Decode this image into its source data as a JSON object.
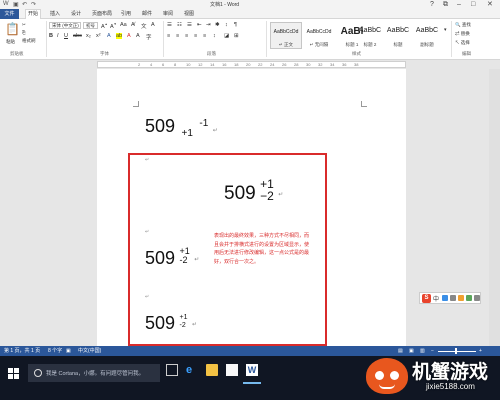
{
  "window": {
    "title": "文档1 - Word",
    "controls": [
      "?",
      "⧉",
      "–",
      "□",
      "✕"
    ]
  },
  "ribbon_tabs": {
    "file": "文件",
    "tabs": [
      "开始",
      "插入",
      "设计",
      "页面布局",
      "引用",
      "邮件",
      "审阅",
      "视图"
    ],
    "active": "开始"
  },
  "clipboard": {
    "paste": "粘贴",
    "cut": "✂",
    "copy": "⎘",
    "format_painter": "格式刷",
    "label": "剪贴板"
  },
  "font": {
    "name": "宋体 (中文正)",
    "size": "初号",
    "label": "字体"
  },
  "paragraph": {
    "label": "段落"
  },
  "styles": {
    "items": [
      {
        "preview": "AaBbCcDd",
        "name": "↵ 正文",
        "selected": true
      },
      {
        "preview": "AaBbCcDd",
        "name": "↵ 无间隔",
        "selected": false
      },
      {
        "preview": "AaBl",
        "name": "标题 1",
        "selected": false
      },
      {
        "preview": "AaBbC",
        "name": "标题 2",
        "selected": false
      },
      {
        "preview": "AaBbC",
        "name": "标题",
        "selected": false
      },
      {
        "preview": "AaBbC",
        "name": "副标题",
        "selected": false
      }
    ],
    "label": "样式"
  },
  "editing": {
    "find": "查找",
    "replace": "替换",
    "select": "选择",
    "label": "编辑"
  },
  "ruler_numbers": [
    "2",
    "4",
    "6",
    "8",
    "10",
    "12",
    "14",
    "16",
    "18",
    "20",
    "22",
    "24",
    "26",
    "28",
    "30",
    "32",
    "34",
    "36",
    "38"
  ],
  "document": {
    "eq1": {
      "base": "509",
      "sub": "+1",
      "sup": "-1"
    },
    "eq2": {
      "base": "509",
      "top": "+1",
      "bottom": "−2"
    },
    "eq3": {
      "base": "509",
      "top": "+1",
      "bottom": "-2"
    },
    "eq4": {
      "base": "509",
      "top": "+1",
      "bottom": "-2"
    },
    "note": "表现出的最终效果，三种方式不尽相同，而且会并于排横式进行的设置为区域显示，使用后无法进行修改编辑，这一点公式是的最好，双行合一次之。"
  },
  "sogou_ime": {
    "logo": "S",
    "mode": "中",
    "icon_colors": [
      "#3a8ee6",
      "#888888",
      "#f0a030",
      "#5aa55a",
      "#888888"
    ]
  },
  "statusbar": {
    "page": "第 1 页，共 1 页",
    "words": "8 个字",
    "lang": "中文(中国)"
  },
  "taskbar": {
    "search_placeholder": "我是 Cortana，小娜。有问题尽管问我。"
  },
  "watermark": {
    "name": "机蟹游戏",
    "url": "jixie5188.com"
  },
  "colors": {
    "word_blue": "#2b579a",
    "highlight_red": "#d92b2b"
  }
}
